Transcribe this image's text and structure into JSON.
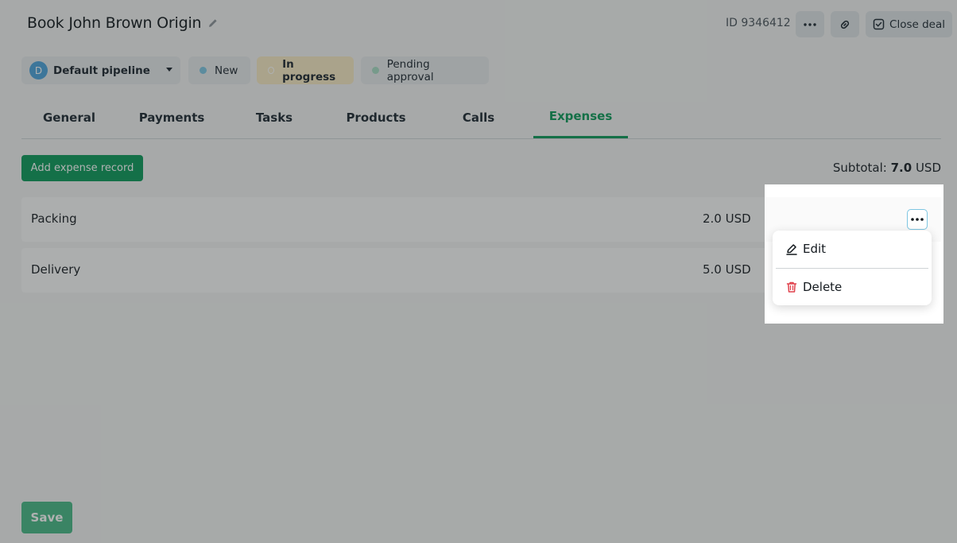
{
  "header": {
    "title": "Book John Brown Origin",
    "deal_id": "ID 9346412",
    "close_label": "Close deal"
  },
  "pipeline": {
    "avatar_letter": "D",
    "selected": "Default pipeline",
    "stages": [
      "New",
      "In progress",
      "Pending approval"
    ],
    "active_stage": "In progress"
  },
  "tabs": [
    "General",
    "Payments",
    "Tasks",
    "Products",
    "Calls",
    "Expenses"
  ],
  "active_tab": "Expenses",
  "toolbar": {
    "add_label": "Add expense record",
    "subtotal_label": "Subtotal:",
    "subtotal_value": "7.0",
    "subtotal_currency": "USD"
  },
  "expenses": [
    {
      "name": "Packing",
      "amount": "2.0 USD"
    },
    {
      "name": "Delivery",
      "amount": "5.0 USD"
    }
  ],
  "menu": {
    "edit_label": "Edit",
    "delete_label": "Delete"
  },
  "footer": {
    "save_label": "Save"
  },
  "colors": {
    "accent": "#0d9a5b",
    "in_progress_bg": "#f7e9c4",
    "delete_icon": "#e0404b",
    "avatar": "#4da3dc"
  },
  "icons": [
    "pencil-icon",
    "more-dots-icon",
    "link-icon",
    "check-square-icon",
    "chevron-down-icon",
    "edit-icon",
    "trash-icon"
  ]
}
